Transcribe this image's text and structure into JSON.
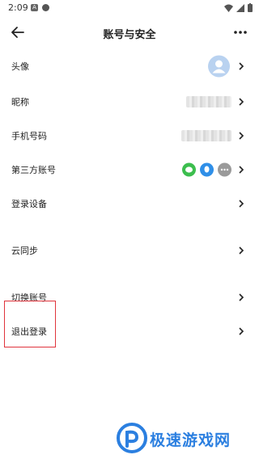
{
  "status_bar": {
    "time": "2:09",
    "icon_a": "A",
    "icon_b": "settings-notification-icon"
  },
  "header": {
    "title": "账号与安全",
    "back_icon": "arrow-left-icon",
    "more_icon": "more-dots-icon"
  },
  "rows": [
    {
      "label": "头像",
      "value_type": "avatar"
    },
    {
      "label": "昵称",
      "value_type": "blurred"
    },
    {
      "label": "手机号码",
      "value_type": "blurred"
    },
    {
      "label": "第三方账号",
      "value_type": "social-icons"
    },
    {
      "label": "登录设备",
      "value_type": "none"
    },
    {
      "label": "云同步",
      "value_type": "none"
    },
    {
      "label": "切换账号",
      "value_type": "none"
    },
    {
      "label": "退出登录",
      "value_type": "none"
    }
  ],
  "social_icons": [
    {
      "name": "wechat-icon",
      "color": "#3cbe4e"
    },
    {
      "name": "qq-icon",
      "color": "#2f8fe8"
    },
    {
      "name": "more-icon",
      "color": "#9a9a9a"
    }
  ],
  "colors": {
    "highlight": "#e0343c",
    "avatar_bg": "#b9d2f0",
    "watermark": "#2b7fe0"
  },
  "watermark": {
    "text": "极速游戏网"
  }
}
